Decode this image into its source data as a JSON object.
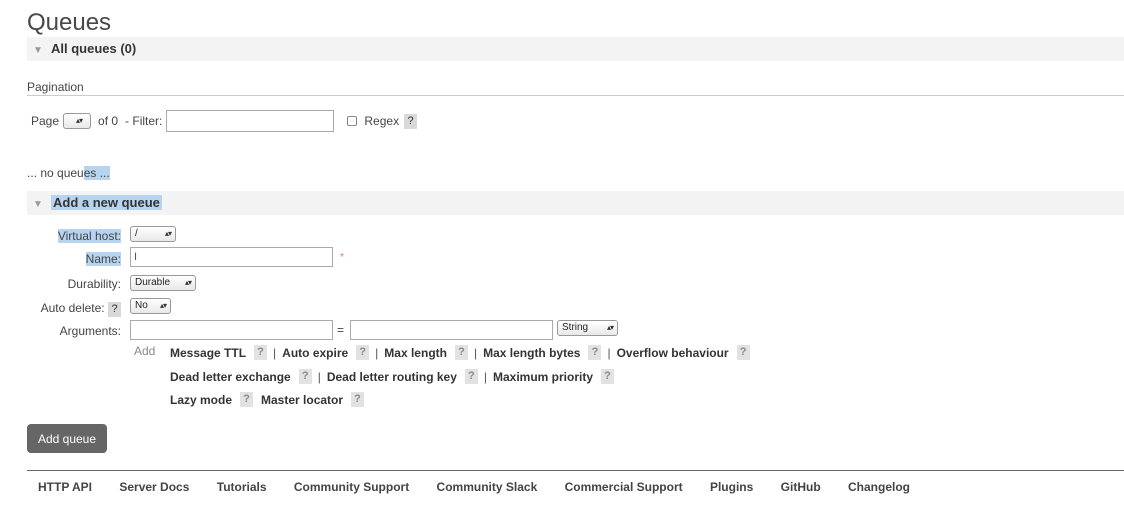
{
  "page": {
    "title": "Queues"
  },
  "all_queues": {
    "label": "All queues (0)"
  },
  "pagination": {
    "title": "Pagination",
    "page_label": "Page",
    "of_label": "of 0",
    "filter_label": "- Filter:",
    "filter_value": "",
    "regex_label": "Regex",
    "help": "?"
  },
  "no_queues": {
    "prefix": "... no queu",
    "highlighted": "es ..."
  },
  "add_queue": {
    "header": "Add a new queue",
    "virtual_host_label": "Virtual host:",
    "virtual_host_value": "/",
    "name_label": "Name:",
    "name_value": "",
    "required_marker": "*",
    "durability_label": "Durability:",
    "durability_value": "Durable",
    "auto_delete_label": "Auto delete:",
    "auto_delete_value": "No",
    "arguments_label": "Arguments:",
    "arg_key": "",
    "equals": "=",
    "arg_value": "",
    "arg_type": "String",
    "add_label": "Add",
    "arg_rows": [
      [
        "Message TTL",
        "Auto expire",
        "Max length",
        "Max length bytes",
        "Overflow behaviour"
      ],
      [
        "Dead letter exchange",
        "Dead letter routing key",
        "Maximum priority"
      ],
      [
        "Lazy mode",
        "Master locator"
      ]
    ],
    "button_label": "Add queue"
  },
  "footer": {
    "links": [
      "HTTP API",
      "Server Docs",
      "Tutorials",
      "Community Support",
      "Community Slack",
      "Commercial Support",
      "Plugins",
      "GitHub",
      "Changelog"
    ]
  },
  "icons": {
    "collapse": "triangle-down-icon",
    "select": "updown-arrows-icon"
  }
}
